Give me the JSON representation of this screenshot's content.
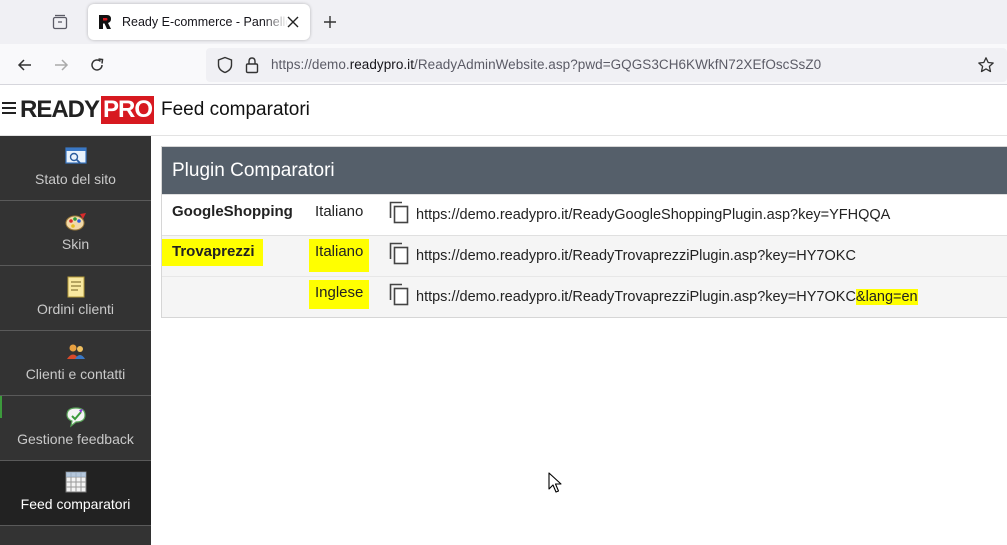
{
  "browser": {
    "tab_title": "Ready E-commerce - Pannello di amministrazione",
    "url_prefix": "https://demo.",
    "url_domain": "readypro.it",
    "url_path": "/ReadyAdminWebsite.asp?pwd=GQGS3CH6KWkfN72XEfOscSsZ0",
    "icons": [
      "tab-list-icon",
      "favicon-icon",
      "close-icon",
      "plus-icon",
      "back-icon",
      "forward-icon",
      "reload-icon",
      "shield-icon",
      "lock-icon",
      "star-icon"
    ]
  },
  "header": {
    "logo_ready": "READY",
    "logo_pro": "PRO",
    "page_title": "Feed comparatori"
  },
  "sidebar": {
    "items": [
      {
        "label": "Stato del sito",
        "icon": "site-status-icon"
      },
      {
        "label": "Skin",
        "icon": "palette-icon"
      },
      {
        "label": "Ordini clienti",
        "icon": "orders-icon"
      },
      {
        "label": "Clienti e contatti",
        "icon": "contacts-icon"
      },
      {
        "label": "Gestione feedback",
        "icon": "feedback-icon"
      },
      {
        "label": "Feed comparatori",
        "icon": "grid-icon",
        "active": true
      }
    ]
  },
  "panel": {
    "title": "Plugin Comparatori",
    "rows": [
      {
        "plugin": "GoogleShopping",
        "language": "Italiano",
        "url": "https://demo.readypro.it/ReadyGoogleShoppingPlugin.asp?key=YFHQQA"
      },
      {
        "plugin": "Trovaprezzi",
        "language": "Italiano",
        "url": "https://demo.readypro.it/ReadyTrovaprezziPlugin.asp?key=HY7OKC"
      },
      {
        "plugin": "",
        "language": "Inglese",
        "url": "https://demo.readypro.it/ReadyTrovaprezziPlugin.asp?key=HY7OKC",
        "url_suffix": "&lang=en"
      }
    ]
  },
  "colors": {
    "highlight": "#ffff00",
    "panel_header": "#555f6a",
    "sidebar": "#333333",
    "brand_red": "#d71920"
  }
}
